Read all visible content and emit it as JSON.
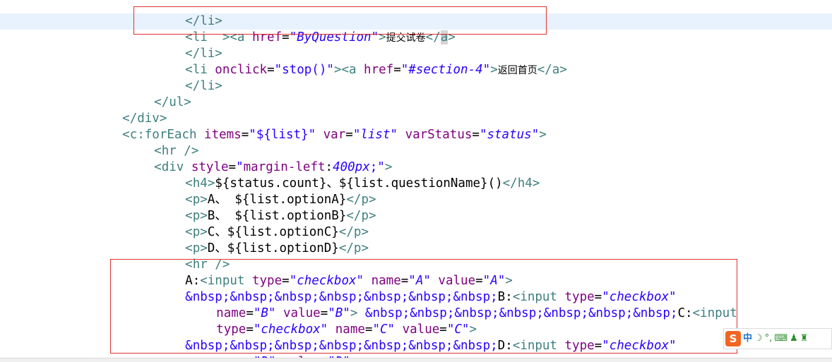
{
  "code": {
    "l0_close_li": "</li>",
    "l1_open": "<li  >",
    "l1_a": "<a",
    "l1_href_attr": " href",
    "l1_eq": "=",
    "l1_href_val": "\"ByQuestion\"",
    "l1_gt": ">",
    "l1_text": "提交试卷",
    "l1_lt": "</",
    "l1_a_caret": "a",
    "l1_end": ">",
    "l2_close_li": "</li>",
    "l3_li": "<li",
    "l3_onclick_attr": " onclick",
    "l3_eq": "=",
    "l3_onclick_val": "\"stop()\"",
    "l3_gt_a": "><a",
    "l3_href_attr": " href",
    "l3_eq2": "=",
    "l3_href_val": "\"#section-4\"",
    "l3_gt": ">",
    "l3_text": "返回首页",
    "l3_close": "</a>",
    "l4_close_li": "</li>",
    "l5_close_ul": "</ul>",
    "l6_close_div": "</div>",
    "l7_foreach": "<c:forEach",
    "l7_items_attr": " items",
    "l7_eq": "=",
    "l7_items_val": "\"${list}\"",
    "l7_var_attr": " var",
    "l7_eq2": "=",
    "l7_var_val": "\"list\"",
    "l7_status_attr": " varStatus",
    "l7_eq3": "=",
    "l7_status_val": "\"status\"",
    "l7_gt": ">",
    "l8_hr": "<hr />",
    "l9_div": "<div",
    "l9_style_attr": " style",
    "l9_eq": "=",
    "l9_style_q1": "\"",
    "l9_style_prop": "margin-left",
    "l9_style_colon": ":",
    "l9_style_value": "400px",
    "l9_style_q2": ";\"",
    "l9_gt": ">",
    "l10_h4": "<h4>",
    "l10_text": "${status.count}、${list.questionName}()",
    "l10_close": "</h4>",
    "l11_p": "<p>",
    "l11_text": "A、 ${list.optionA}",
    "l11_close": "</p>",
    "l12_p": "<p>",
    "l12_text": "B、 ${list.optionB}",
    "l12_close": "</p>",
    "l13_p": "<p>",
    "l13_text": "C、${list.optionC}",
    "l13_close": "</p>",
    "l14_p": "<p>",
    "l14_text": "D、${list.optionD}",
    "l14_close": "</p>",
    "l15_hr": "<hr />",
    "l16_label": "A:",
    "l16_input": "<input",
    "l16_type_attr": " type",
    "l16_eq": "=",
    "l16_type_val": "\"checkbox\"",
    "l16_name_attr": " name",
    "l16_eq2": "=",
    "l16_name_val": "\"A\"",
    "l16_value_attr": " value",
    "l16_eq3": "=",
    "l16_value_val": "\"A\"",
    "l16_gt": ">",
    "l17_nbsp": "&nbsp;&nbsp;&nbsp;&nbsp;&nbsp;&nbsp;&nbsp;",
    "l17_label": "B:",
    "l17_input": "<input",
    "l17_type_attr": " type",
    "l17_eq": "=",
    "l17_type_val": "\"checkbox\"",
    "l18_name_attr": "name",
    "l18_eq": "=",
    "l18_name_val": "\"B\"",
    "l18_value_attr": " value",
    "l18_eq2": "=",
    "l18_value_val": "\"B\"",
    "l18_gt": ">",
    "l18_nbsp": " &nbsp;&nbsp;&nbsp;&nbsp;&nbsp;&nbsp;&nbsp;",
    "l18_label": "C:",
    "l18_input": "<input",
    "l19_type_attr": "type",
    "l19_eq": "=",
    "l19_type_val": "\"checkbox\"",
    "l19_name_attr": " name",
    "l19_eq2": "=",
    "l19_name_val": "\"C\"",
    "l19_value_attr": " value",
    "l19_eq3": "=",
    "l19_value_val": "\"C\"",
    "l19_gt": ">",
    "l20_nbsp": "&nbsp;&nbsp;&nbsp;&nbsp;&nbsp;&nbsp;&nbsp;",
    "l20_label": "D:",
    "l20_input": "<input",
    "l20_type_attr": " type",
    "l20_eq": "=",
    "l20_type_val": "\"checkbox\"",
    "l21_name_attr": "name",
    "l21_eq": "=",
    "l21_name_val": "\"D\"",
    "l21_value_attr": " value",
    "l21_eq2": "=",
    "l21_value_val": "\"D\"",
    "l21_gt": ">"
  },
  "ime": {
    "logo": "S",
    "lang": "中",
    "moon": "☽",
    "dots": "°,",
    "keyboard": "⌨",
    "user": "♟",
    "shirt": "♜"
  },
  "colors": {
    "tag": "#3f7f7f",
    "attribute": "#7f007f",
    "string": "#2a00ff",
    "highlight": "#e8f2fe",
    "annotation_box": "#e03030",
    "ime_logo": "#f26522"
  }
}
